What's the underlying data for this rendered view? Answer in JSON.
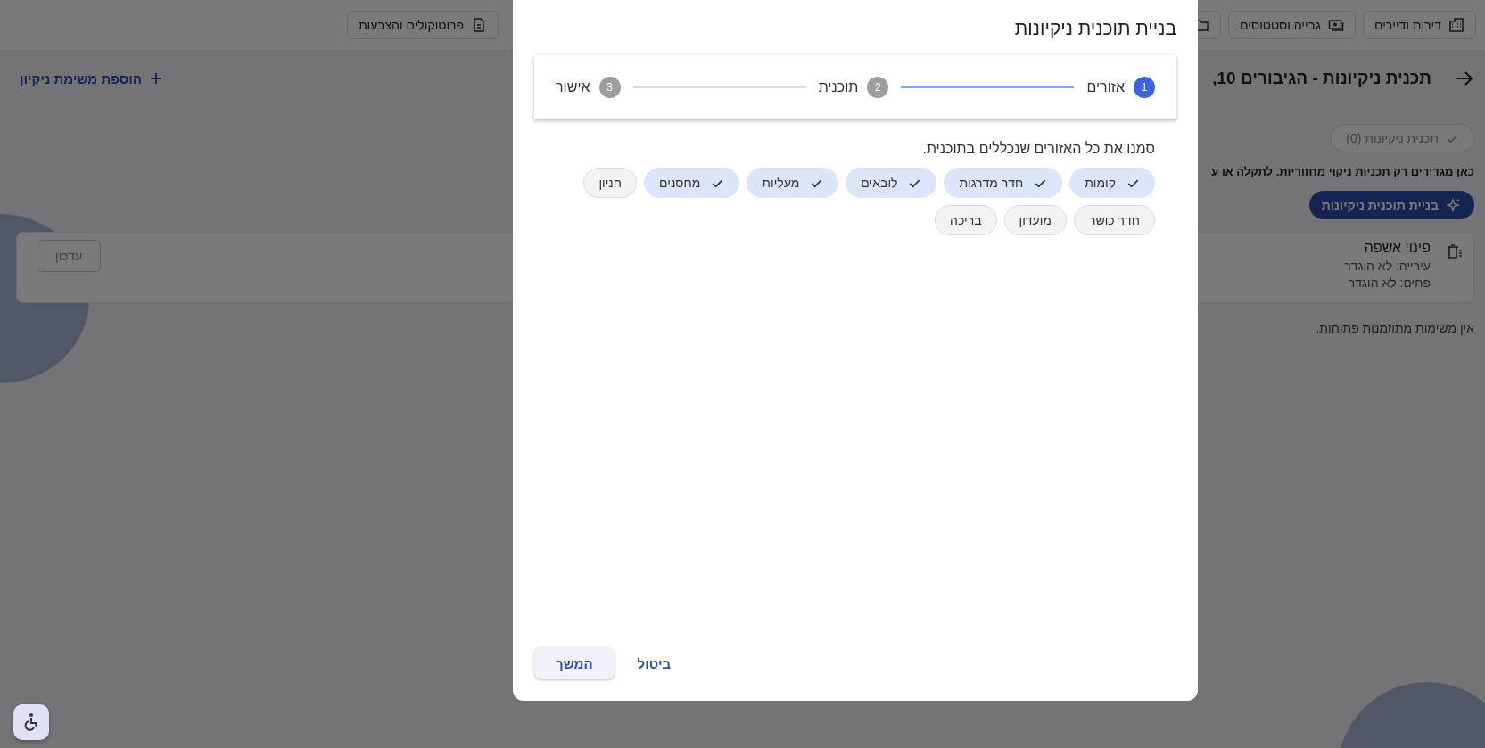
{
  "top_nav": {
    "items": [
      {
        "kind": "building",
        "label": "דירות ודיירים"
      },
      {
        "kind": "cash",
        "label": "גבייה וסטטוסים"
      },
      {
        "kind": "folder"
      }
    ],
    "protocols_button": "פרוטוקולים והצבעות"
  },
  "page": {
    "title": "תכנית ניקיונות - הגיבורים 10,",
    "add_task_link": "הוספת משימת ניקיון",
    "plan_chip": "תכנית ניקיונות (0)",
    "notice": "כאן מגדירים רק תכניות ניקוי מחזוריות. לתקלה או ע",
    "build_button": "בניית תוכנית ניקיונות",
    "tasks": [
      {
        "title": "פינוי אשפה",
        "details": [
          "עירייה: לא הוגדר",
          "פחים: לא הוגדר"
        ],
        "action": "עדכון"
      }
    ],
    "empty_message": "אין משימות מתוזמנות פתוחות."
  },
  "dialog": {
    "title": "בניית תוכנית ניקיונות",
    "steps": [
      {
        "number": "1",
        "label": "אזורים",
        "selected": true
      },
      {
        "number": "2",
        "label": "תוכנית",
        "selected": false
      },
      {
        "number": "3",
        "label": "אישור",
        "selected": false
      }
    ],
    "instruction": "סמנו את כל האזורים שנכללים בתוכנית.",
    "areas": [
      {
        "label": "קומות",
        "selected": true
      },
      {
        "label": "חדר מדרגות",
        "selected": true
      },
      {
        "label": "לובאים",
        "selected": true
      },
      {
        "label": "מעליות",
        "selected": true
      },
      {
        "label": "מחסנים",
        "selected": true
      },
      {
        "label": "חניון",
        "selected": false
      },
      {
        "label": "חדר כושר",
        "selected": false
      },
      {
        "label": "מועדון",
        "selected": false
      },
      {
        "label": "בריכה",
        "selected": false
      }
    ],
    "cancel_button": "ביטול",
    "continue_button": "המשך"
  }
}
